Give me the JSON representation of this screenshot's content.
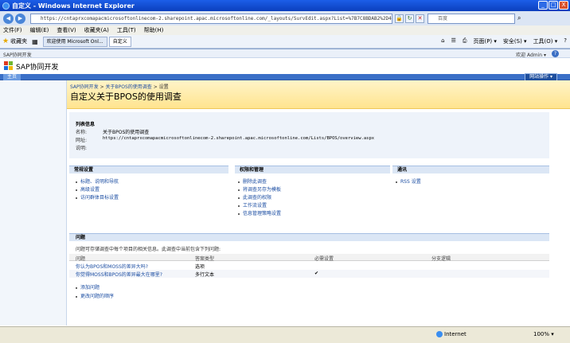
{
  "window": {
    "title": "自定义 - Windows Internet Explorer",
    "min": "_",
    "max": "□",
    "close": "X"
  },
  "address": {
    "url": "https://cntaprxcomapacmicrosoftonlinecom-2.sharepoint.apac.microsoftonline.com/_layouts/SurvEdit.aspx?List=%7B7C8BDAB2%2D4E",
    "search_placeholder": "百度"
  },
  "menu": [
    "文件(F)",
    "编辑(E)",
    "查看(V)",
    "收藏夹(A)",
    "工具(T)",
    "帮助(H)"
  ],
  "favbar": {
    "favorites": "收藏夹",
    "tabs": [
      "欢迎使用 Microsoft Onl...",
      "自定义"
    ],
    "commands": [
      "页面(P) ▾",
      "安全(S) ▾",
      "工具(O) ▾"
    ]
  },
  "sp": {
    "site_small": "SAP协同开发",
    "welcome": "欢迎 Admin ▾",
    "site_title": "SAP协同开发",
    "home_tab": "主页",
    "site_actions": "网站操作 ▾",
    "breadcrumb": [
      "SAP协同开发",
      "关于BPOS的使用调查",
      "设置"
    ],
    "page_title": "自定义关于BPOS的使用调查"
  },
  "list_info": {
    "header": "列表信息",
    "rows": [
      {
        "label": "名称:",
        "value": "关于BPOS的使用调查"
      },
      {
        "label": "网址:",
        "value": "https://cntaprxcomapacmicrosoftonlinecom-2.sharepoint.apac.microsoftonline.com/Lists/BPOS/overview.aspx"
      },
      {
        "label": "说明:",
        "value": ""
      }
    ]
  },
  "columns": [
    {
      "header": "常规设置",
      "links": [
        "标题、说明和导航",
        "高级设置",
        "访问群体目标设置"
      ]
    },
    {
      "header": "权限和管理",
      "links": [
        "删除此调查",
        "将调查另存为模板",
        "此调查的权限",
        "工作流设置",
        "信息管理策略设置"
      ]
    },
    {
      "header": "通讯",
      "links": [
        "RSS 设置"
      ]
    }
  ],
  "questions": {
    "header": "问题",
    "description": "问题可存储调查中每个项目的相关信息。此调查中当前包含下列问题:",
    "table_headers": [
      "问题",
      "答案类型",
      "必需设置",
      "分支逻辑"
    ],
    "rows": [
      {
        "question": "你认为BPOS和MOSS的差异大吗?",
        "type": "选项",
        "required": ""
      },
      {
        "question": "你觉得MOSS和BPOS的差异最大在哪里?",
        "type": "多行文本",
        "required": "✔"
      }
    ],
    "actions": [
      "添加问题",
      "更改问题的顺序"
    ]
  },
  "status": {
    "zone": "Internet",
    "zoom": "100% ▾"
  }
}
